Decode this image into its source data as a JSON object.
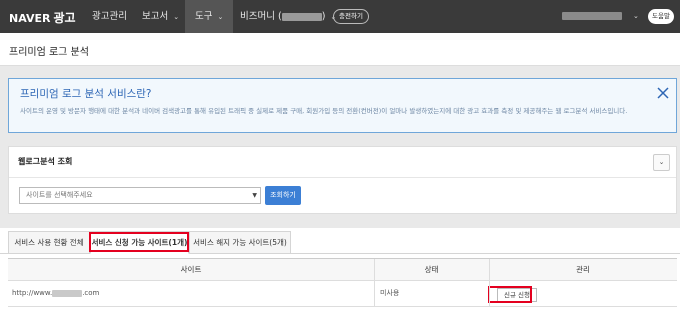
{
  "header": {
    "logo_brand": "NAVER",
    "logo_sub": "광고",
    "nav": {
      "ad_manage": "광고관리",
      "reports": "보고서",
      "tools": "도구",
      "bizmoney": "비즈머니 (",
      "bizmoney_close": ")"
    },
    "charge_label": "충전하기",
    "help_label": "도움말"
  },
  "page": {
    "title": "프리미엄 로그 분석"
  },
  "info": {
    "title": "프리미엄 로그 분석 서비스란?",
    "text": "사이트의 운영 및 방문자 행태에 대한 분석과 네이버 검색광고를 통해 유입된 트래픽 중 실제로 제품 구매, 회원가입 등의 전환(컨버전)이 얼마나 발생하였는지에 대한 광고 효과를 측정 및 제공해주는 웹 로그분석 서비스입니다."
  },
  "query_panel": {
    "title": "웹로그분석 조회",
    "select_placeholder": "사이트를 선택해주세요",
    "query_button": "조회하기"
  },
  "tabs": [
    {
      "label": "서비스 사용 현황 전체"
    },
    {
      "label": "서비스 신청 가능 사이트(1개)"
    },
    {
      "label": "서비스 해지 가능 사이트(5개)"
    }
  ],
  "table": {
    "headers": [
      "사이트",
      "상태",
      "관리"
    ],
    "rows": [
      {
        "site_prefix": "http://www.",
        "site_suffix": ".com",
        "status": "미사용",
        "action": "신규 신청"
      }
    ]
  },
  "colors": {
    "topbar": "#3a3a3a",
    "accent": "#3c7fd5",
    "highlight": "#e4001f"
  },
  "icons": {
    "close": "close-icon",
    "chevron": "chevron-down-icon"
  }
}
